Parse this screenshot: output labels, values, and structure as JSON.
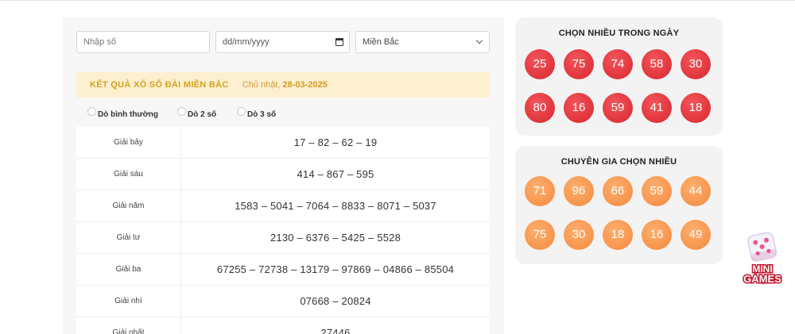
{
  "filters": {
    "number_placeholder": "Nhập số",
    "date_placeholder": "dd/mm/yyyy",
    "region_selected": "Miền Bắc"
  },
  "banner": {
    "title": "KẾT QUẢ XỔ SỐ ĐÀI MIỀN BẮC",
    "day": "Chủ nhật,",
    "date": "28-03-2025"
  },
  "modes": [
    "Dò bình thường",
    "Dò 2 số",
    "Dò 3 số"
  ],
  "results": [
    {
      "name": "Giải bảy",
      "numbers": "17 – 82 – 62 – 19"
    },
    {
      "name": "Giải sáu",
      "numbers": "414 – 867 – 595"
    },
    {
      "name": "Giải năm",
      "numbers": "1583 – 5041 – 7064 – 8833 – 8071 – 5037"
    },
    {
      "name": "Giải tư",
      "numbers": "2130 – 6376 – 5425 – 5528"
    },
    {
      "name": "Giải ba",
      "numbers": "67255 – 72738 – 13179 – 97869 – 04866 – 85504"
    },
    {
      "name": "Giải nhì",
      "numbers": "07668 – 20824"
    },
    {
      "name": "Giải nhất",
      "numbers": "27446"
    }
  ],
  "popular_today": {
    "title": "CHỌN NHIỀU TRONG NGÀY",
    "numbers": [
      "25",
      "75",
      "74",
      "58",
      "30",
      "80",
      "16",
      "59",
      "41",
      "18"
    ],
    "color": "#e0333a"
  },
  "expert_picks": {
    "title": "CHUYÊN GIA CHỌN NHIỀU",
    "numbers": [
      "71",
      "96",
      "66",
      "59",
      "44",
      "75",
      "30",
      "18",
      "16",
      "49"
    ],
    "color": "#f7944a"
  },
  "mini_games": {
    "icon": "dice-icon",
    "label_line1": "MINI",
    "label_line2": "GAMES"
  }
}
